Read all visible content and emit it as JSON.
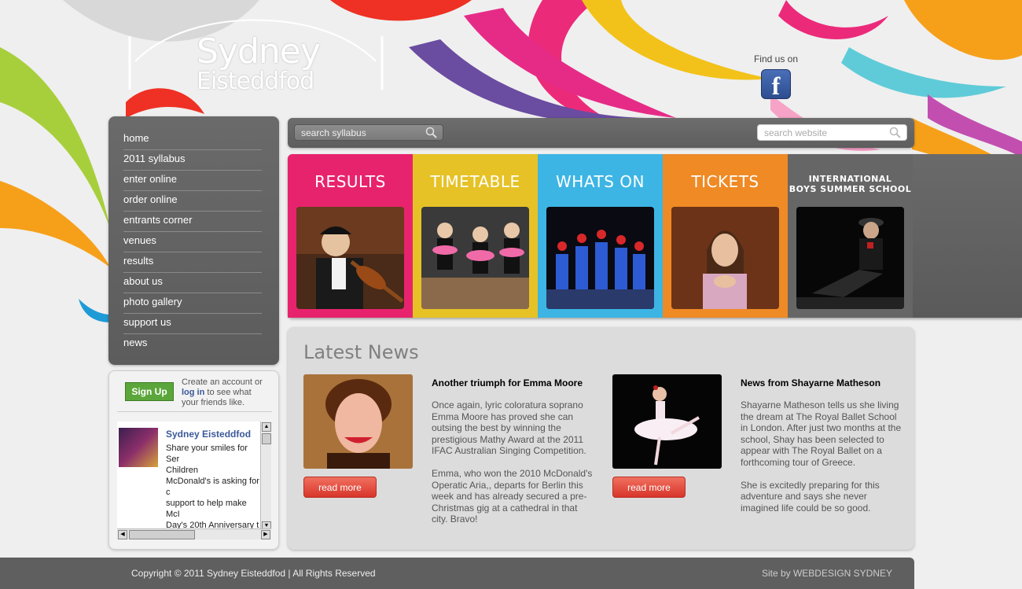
{
  "header": {
    "logo_line1": "Sydney",
    "logo_line2": "Eisteddfod",
    "find_us": "Find us on",
    "facebook_glyph": "f"
  },
  "nav": {
    "items": [
      {
        "label": "home"
      },
      {
        "label": "2011 syllabus"
      },
      {
        "label": "enter online"
      },
      {
        "label": "order online"
      },
      {
        "label": "entrants corner"
      },
      {
        "label": "venues"
      },
      {
        "label": "results"
      },
      {
        "label": "about us"
      },
      {
        "label": "photo gallery"
      },
      {
        "label": "support us"
      },
      {
        "label": "news"
      }
    ]
  },
  "facebook_widget": {
    "signup": "Sign Up",
    "create_pre": "Create an account or",
    "login": "log in",
    "create_post": "to see what your friends like.",
    "page_name": "Sydney Eisteddfod",
    "post_text": "Share your smiles for Ser\nChildren\nMcDonald's is asking for c\nsupport to help make McI\nDay's 20th Anniversary t\nbiggest year yet! For an\ninterested and available,\nToday Show will be filmin"
  },
  "search": {
    "syllabus_placeholder": "search syllabus",
    "website_placeholder": "search website"
  },
  "tiles": [
    {
      "title": "RESULTS",
      "color": "#e8236d"
    },
    {
      "title": "TIMETABLE",
      "color": "#e6c226"
    },
    {
      "title": "WHATS ON",
      "color": "#3cb5e4"
    },
    {
      "title": "TICKETS",
      "color": "#ef8a25"
    },
    {
      "title_line1": "INTERNATIONAL",
      "title_line2": "BOYS SUMMER SCHOOL",
      "color": "#666666"
    }
  ],
  "news": {
    "heading": "Latest News",
    "items": [
      {
        "title": "Another triumph for Emma Moore",
        "body": "Once again, lyric coloratura soprano Emma Moore has proved she can outsing the best by winning the prestigious Mathy Award at the 2011 IFAC Australian Singing Competition.\n\nEmma, who won the 2010 McDonald's Operatic Aria,, departs for Berlin this week and has already secured a pre-Christmas gig at a cathedral in that city.  Bravo!",
        "read_more": "read more"
      },
      {
        "title": "News from Shayarne Matheson",
        "body": " Shayarne Matheson tells us she living the dream at The Royal Ballet School in London.  After just two months at the school,  Shay has been selected to appear with The Royal Ballet on a forthcoming tour of Greece.\n\nShe is excitedly preparing for this adventure and says she never imagined life could be so good.",
        "read_more": "read more"
      }
    ]
  },
  "footer": {
    "copyright": "Copyright © 2011 Sydney Eisteddfod   |   All Rights Reserved",
    "site_by": "Site by  WEBDESIGN SYDNEY"
  }
}
